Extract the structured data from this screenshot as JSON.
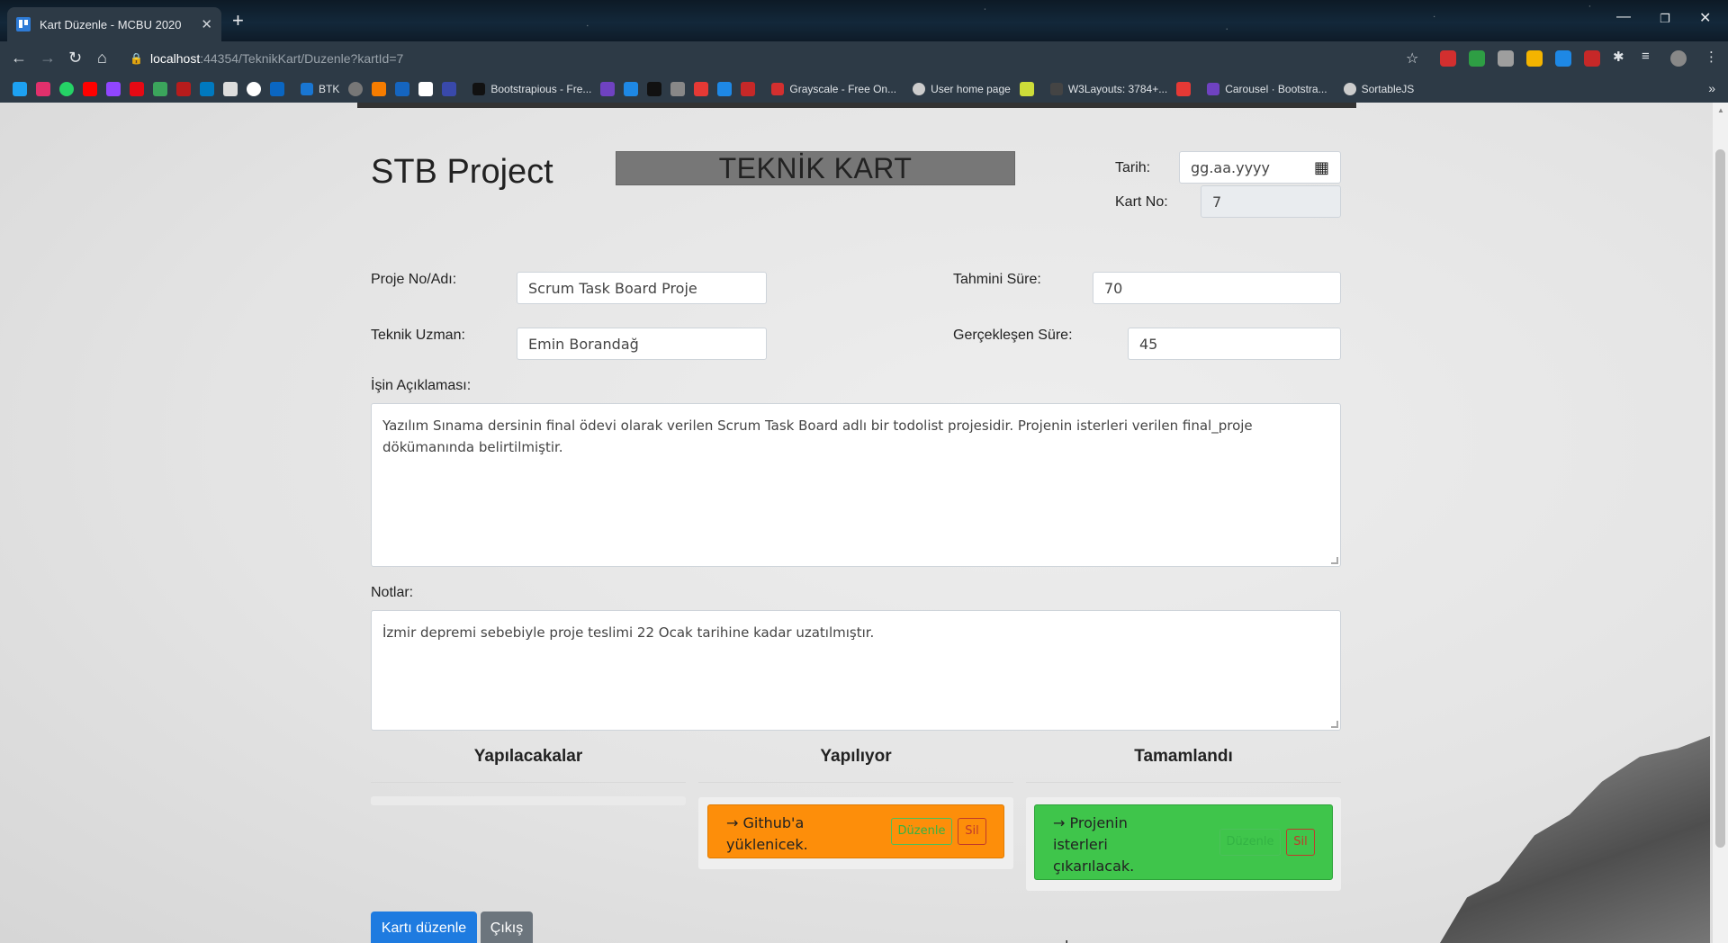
{
  "browser": {
    "tab_title": "Kart Düzenle - MCBU 2020",
    "url_host": "localhost",
    "url_path": ":44354/TeknikKart/Duzenle?kartId=7",
    "bookmarks": [
      {
        "label": "Bootstrapious - Fre...",
        "color": "#111"
      },
      {
        "label": "Grayscale - Free On...",
        "color": "#d32f2f"
      },
      {
        "label": "User home page",
        "color": "#ccc"
      },
      {
        "label": "W3Layouts: 3784+...",
        "color": "#444"
      },
      {
        "label": "Carousel · Bootstra...",
        "color": "#6f42c1"
      },
      {
        "label": "SortableJS",
        "color": "#ccc"
      }
    ],
    "btk_label": "BTK"
  },
  "page": {
    "brand": "STB Project",
    "banner": "TEKNİK KART"
  },
  "form": {
    "tarih_label": "Tarih:",
    "tarih_value": "gg.aa.yyyy",
    "kart_no_label": "Kart No:",
    "kart_no_value": "7",
    "proje_label": "Proje No/Adı:",
    "proje_value": "Scrum Task Board Proje",
    "tahmini_label": "Tahmini Süre:",
    "tahmini_value": "70",
    "uzman_label": "Teknik Uzman:",
    "uzman_value": "Emin Borandağ",
    "gerceklesen_label": "Gerçekleşen Süre:",
    "gerceklesen_value": "45",
    "aciklama_label": "İşin Açıklaması:",
    "aciklama_value": "Yazılım Sınama dersinin final ödevi olarak verilen Scrum Task Board adlı bir todolist projesidir. Projenin isterleri verilen final_proje dökümanında belirtilmiştir.",
    "notlar_label": "Notlar:",
    "notlar_value": "İzmir depremi sebebiyle proje teslimi 22 Ocak tarihine kadar uzatılmıştır."
  },
  "board": {
    "columns": [
      "Yapılacakalar",
      "Yapılıyor",
      "Tamamlandı"
    ],
    "tasks": {
      "yapiliyor": {
        "text": "→ Github'a yüklenicek.",
        "edit": "Düzenle",
        "delete": "Sil"
      },
      "tamamlandi": {
        "text": "→ Projenin isterleri çıkarılacak.",
        "edit": "Düzenle",
        "delete": "Sil"
      }
    }
  },
  "actions": {
    "edit_card": "Kartı düzenle",
    "exit": "Çıkış"
  }
}
